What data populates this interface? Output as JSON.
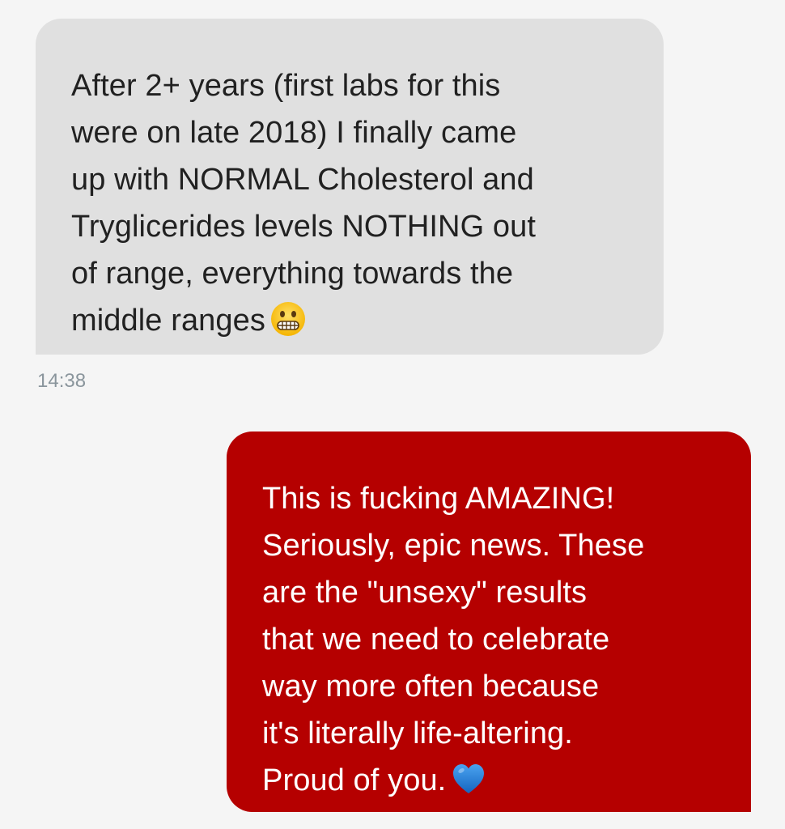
{
  "conversation": {
    "incoming": {
      "text": "After 2+ years (first labs for this\nwere on late 2018) I finally came\nup with NORMAL Cholesterol and\nTryglicerides levels NOTHING out\nof range, everything towards the\nmiddle ranges",
      "emoji": "grimacing-face-emoji",
      "timestamp": "14:38",
      "bubble_color": "#e0e0e0"
    },
    "outgoing": {
      "text": "This is fucking AMAZING!\nSeriously, epic news. These\nare the \"unsexy\" results\nthat we need to celebrate\nway more often because\nit's literally life-altering.\nProud of you.",
      "emoji": "blue-heart-emoji",
      "bubble_color": "#b50000"
    }
  }
}
